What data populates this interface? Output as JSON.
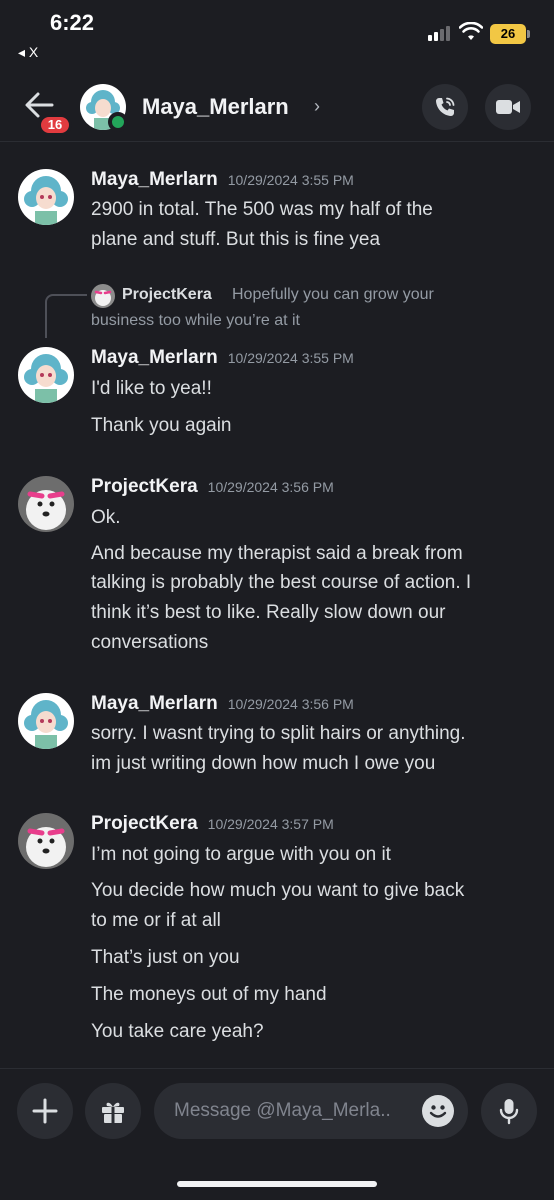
{
  "status": {
    "time": "6:22",
    "back_app": "◂ X",
    "battery": "26"
  },
  "header": {
    "unread_badge": "16",
    "name": "Maya_Merlarn",
    "chevron": "›"
  },
  "reply": {
    "author": "ProjectKera",
    "text_part1": "Hopefully you can grow your",
    "text_part2": "business too while you’re at it"
  },
  "messages": [
    {
      "author": "Maya_Merlarn",
      "timestamp": "10/29/2024 3:55 PM",
      "lines": [
        "2900 in total.  The 500 was my half of the",
        "plane and stuff.  But this is fine yea"
      ]
    },
    {
      "author": "Maya_Merlarn",
      "timestamp": "10/29/2024 3:55 PM",
      "lines": [
        "I'd like to yea!!",
        "Thank you again"
      ]
    },
    {
      "author": "ProjectKera",
      "timestamp": "10/29/2024 3:56 PM",
      "lines": [
        "Ok.",
        "And because my therapist said a break from",
        "talking is probably the best course of action. I",
        "think it’s best to like. Really slow down our",
        "conversations"
      ]
    },
    {
      "author": "Maya_Merlarn",
      "timestamp": "10/29/2024 3:56 PM",
      "lines": [
        "sorry.  I wasnt trying to split hairs or anything.",
        "im just writing down how much I owe you"
      ]
    },
    {
      "author": "ProjectKera",
      "timestamp": "10/29/2024 3:57 PM",
      "lines": [
        "I’m not going to argue with you on it",
        "You decide how much you want to give back",
        "to me or if at all",
        "That’s just on you",
        "The moneys out of my hand",
        "You take care yeah?"
      ]
    }
  ],
  "composer": {
    "placeholder": "Message @Maya_Merla.."
  },
  "colors": {
    "background": "#1c1d22",
    "badge": "#e23b3f",
    "online": "#23a55a",
    "battery": "#f2c744",
    "kera_accent": "#e83e8c"
  },
  "icons": [
    "back-arrow-icon",
    "call-icon",
    "video-icon",
    "plus-icon",
    "gift-icon",
    "emoji-icon",
    "mic-icon",
    "wifi-icon",
    "signal-icon"
  ]
}
